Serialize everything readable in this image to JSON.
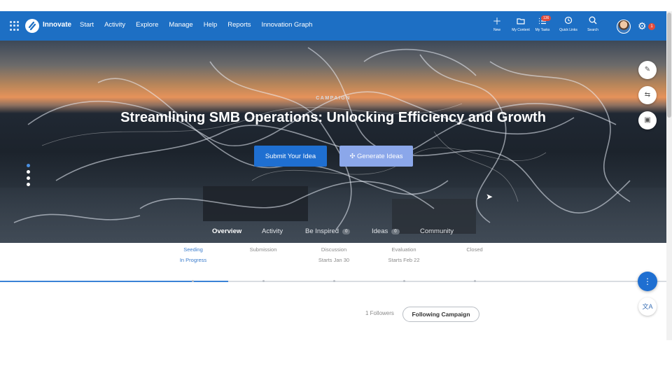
{
  "topbar": {
    "brand": "Innovate",
    "nav": [
      "Start",
      "Activity",
      "Explore",
      "Manage",
      "Help",
      "Reports",
      "Innovation Graph"
    ],
    "tools": [
      {
        "label": "New",
        "icon": "plus-icon"
      },
      {
        "label": "My Content",
        "icon": "folder-icon"
      },
      {
        "label": "My Tasks",
        "icon": "tasks-icon",
        "badge": "136"
      },
      {
        "label": "Quick Links",
        "icon": "history-icon"
      },
      {
        "label": "Search",
        "icon": "search-icon"
      }
    ],
    "notifications": "1",
    "colors": {
      "bar": "#1d6fc4",
      "badge": "#e24b3b"
    }
  },
  "hero": {
    "kicker": "CAMPAIGN",
    "title": "Streamlining SMB Operations: Unlocking Efficiency and Growth",
    "submit_label": "Submit Your Idea",
    "generate_label": "Generate Ideas",
    "tabs": [
      {
        "label": "Overview",
        "current": true
      },
      {
        "label": "Activity"
      },
      {
        "label": "Be Inspired",
        "count": "0"
      },
      {
        "label": "Ideas",
        "count": "0"
      },
      {
        "label": "Community"
      }
    ]
  },
  "phases": [
    {
      "name": "Seeding",
      "status": "In Progress",
      "active": true
    },
    {
      "name": "Submission",
      "status": ""
    },
    {
      "name": "Discussion",
      "status": "Starts Jan 30"
    },
    {
      "name": "Evaluation",
      "status": "Starts Feb 22"
    },
    {
      "name": "Closed",
      "status": ""
    }
  ],
  "follow": {
    "followers": "1 Followers",
    "button": "Following Campaign"
  },
  "language_glyph": "文A"
}
